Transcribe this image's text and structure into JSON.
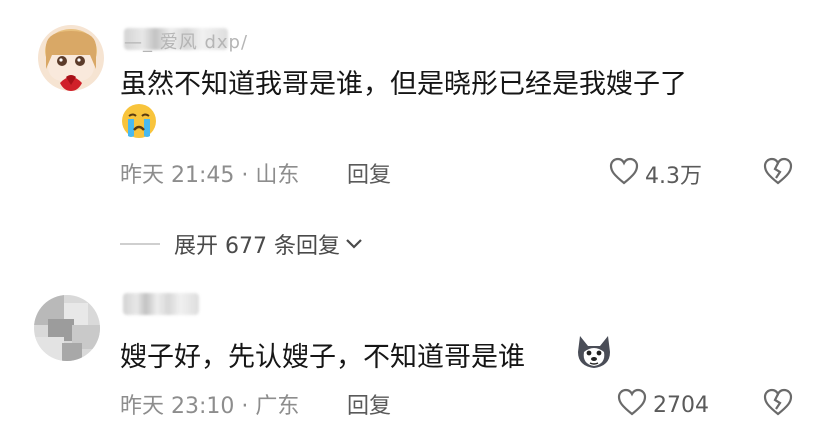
{
  "comments": [
    {
      "username": "—_ 爱风 dxp/",
      "text": "虽然不知道我哥是谁，但是晓彤已经是我嫂子了",
      "emoji": "crying-face-icon",
      "time_location": "昨天 21:45 · 山东",
      "reply_label": "回复",
      "likes": "4.3万"
    },
    {
      "username": "",
      "text": "嫂子好，先认嫂子，不知道哥是谁",
      "emoji": "husky-dog-icon",
      "time_location": "昨天 23:10 · 广东",
      "reply_label": "回复",
      "likes": "2704"
    }
  ],
  "expand_replies": "展开 677 条回复",
  "colors": {
    "text_primary": "#161616",
    "text_meta": "#8d8d8d",
    "divider": "#cfcfcf"
  }
}
